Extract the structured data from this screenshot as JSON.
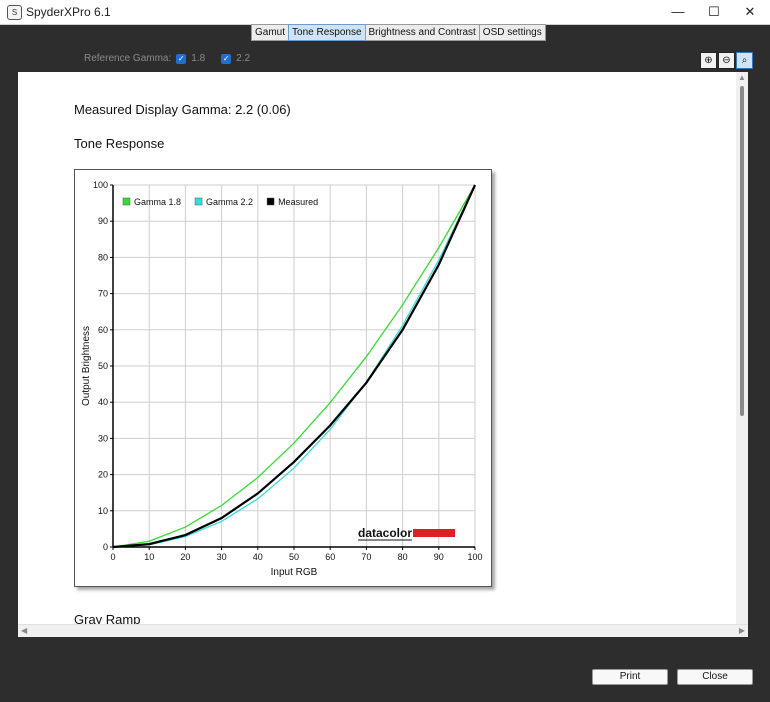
{
  "window": {
    "title": "SpyderXPro 6.1",
    "icon_glyph": "S",
    "controls": {
      "minimize": "—",
      "maximize": "☐",
      "close": "✕"
    }
  },
  "tabs": [
    {
      "label": "Gamut"
    },
    {
      "label": "Tone Response",
      "active": true
    },
    {
      "label": "Brightness and Contrast"
    },
    {
      "label": "OSD settings"
    }
  ],
  "reference": {
    "label": "Reference Gamma:",
    "options": [
      {
        "label": "1.8",
        "checked": true
      },
      {
        "label": "2.2",
        "checked": true
      }
    ]
  },
  "zoom": {
    "icons": [
      "zoom-in-icon",
      "zoom-out-icon",
      "zoom-fit-icon"
    ],
    "glyphs": [
      "⊕",
      "⊖",
      "⌕"
    ]
  },
  "report": {
    "measured": "Measured Display Gamma: 2.2 (0.06)",
    "section": "Tone Response",
    "next_section": "Gray Ramp"
  },
  "chart_data": {
    "type": "line",
    "xlabel": "Input RGB",
    "ylabel": "Output Brightness",
    "xlim": [
      0,
      100
    ],
    "ylim": [
      0,
      100
    ],
    "xticks": [
      0,
      10,
      20,
      30,
      40,
      50,
      60,
      70,
      80,
      90,
      100
    ],
    "yticks": [
      0,
      10,
      20,
      30,
      40,
      50,
      60,
      70,
      80,
      90,
      100
    ],
    "grid": true,
    "legend_position": "top-left",
    "watermark": "datacolor",
    "series": [
      {
        "name": "Gamma 1.8",
        "color": "#33dd33",
        "x": [
          0,
          10,
          20,
          30,
          40,
          50,
          60,
          70,
          80,
          90,
          100
        ],
        "y": [
          0,
          1.6,
          5.5,
          11.5,
          19.2,
          28.7,
          39.9,
          52.6,
          66.9,
          82.7,
          100
        ]
      },
      {
        "name": "Gamma 2.2",
        "color": "#33dddd",
        "x": [
          0,
          10,
          20,
          30,
          40,
          50,
          60,
          70,
          80,
          90,
          100
        ],
        "y": [
          0,
          0.6,
          2.9,
          7.1,
          13.3,
          21.8,
          32.5,
          45.6,
          61.2,
          79.3,
          100
        ]
      },
      {
        "name": "Measured",
        "color": "#000000",
        "x": [
          0,
          10,
          20,
          30,
          40,
          50,
          60,
          70,
          80,
          90,
          100
        ],
        "y": [
          0,
          0.8,
          3.3,
          8.0,
          14.8,
          23.5,
          33.6,
          45.4,
          60.0,
          78.0,
          100
        ]
      }
    ]
  },
  "buttons": {
    "print": "Print",
    "close": "Close"
  }
}
